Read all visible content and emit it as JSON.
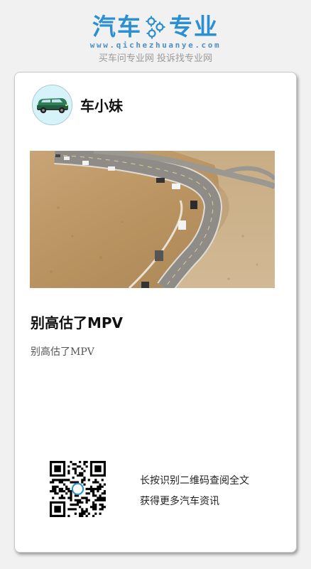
{
  "header": {
    "brand_left": "汽车",
    "brand_right": "专业",
    "url": "www.qichezhuanye.com",
    "slogan": "买车问专业网 投诉找专业网",
    "brand_color": "#2b8fd1"
  },
  "card": {
    "author": "车小妹",
    "article_title": "别高估了MPV",
    "article_summary": "别高估了MPV",
    "qr_prompt_line1": "长按识别二维码查阅全文",
    "qr_prompt_line2": "获得更多汽车资讯",
    "avatar_icon": "car-icon",
    "qr_icon": "qr-code-icon"
  }
}
